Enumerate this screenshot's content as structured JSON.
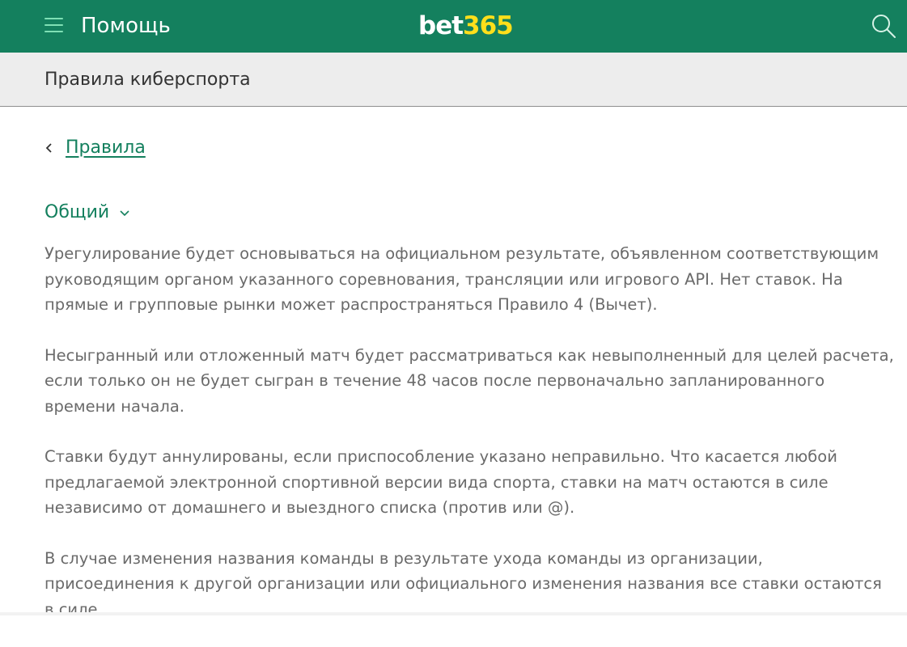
{
  "header": {
    "title": "Помощь",
    "logo_bet": "bet",
    "logo_365": "365",
    "menu_icon": "hamburger-menu-icon",
    "search_icon": "search-icon"
  },
  "subheader": {
    "title": "Правила киберспорта"
  },
  "breadcrumb": {
    "back_label": "Правила",
    "back_icon": "chevron-left-icon"
  },
  "section": {
    "label": "Общий",
    "toggle_icon": "chevron-down-icon"
  },
  "paragraphs": [
    "Урегулирование будет основываться на официальном результате, объявленном соответствующим руководящим органом указанного соревнования, трансляции или игрового API. Нет ставок. На прямые и групповые рынки может распространяться Правило 4 (Вычет).",
    "Несыгранный или отложенный матч будет рассматриваться как невыполненный для целей расчета, если только он не будет сыгран в течение 48 часов после первоначально запланированного времени начала.",
    "Ставки будут аннулированы, если приспособление указано неправильно. Что касается любой предлагаемой электронной спортивной версии вида спорта, ставки на матч остаются в силе независимо от домашнего и выездного списка (против или @).",
    "В случае изменения названия команды в результате ухода команды из организации, присоединения к другой организации или официального изменения названия все ставки остаются в силе."
  ],
  "colors": {
    "brand_green": "#14805e",
    "menu_accent": "#7fe0b5",
    "logo_yellow": "#ffdf1b",
    "body_text": "#6a6a6a"
  }
}
